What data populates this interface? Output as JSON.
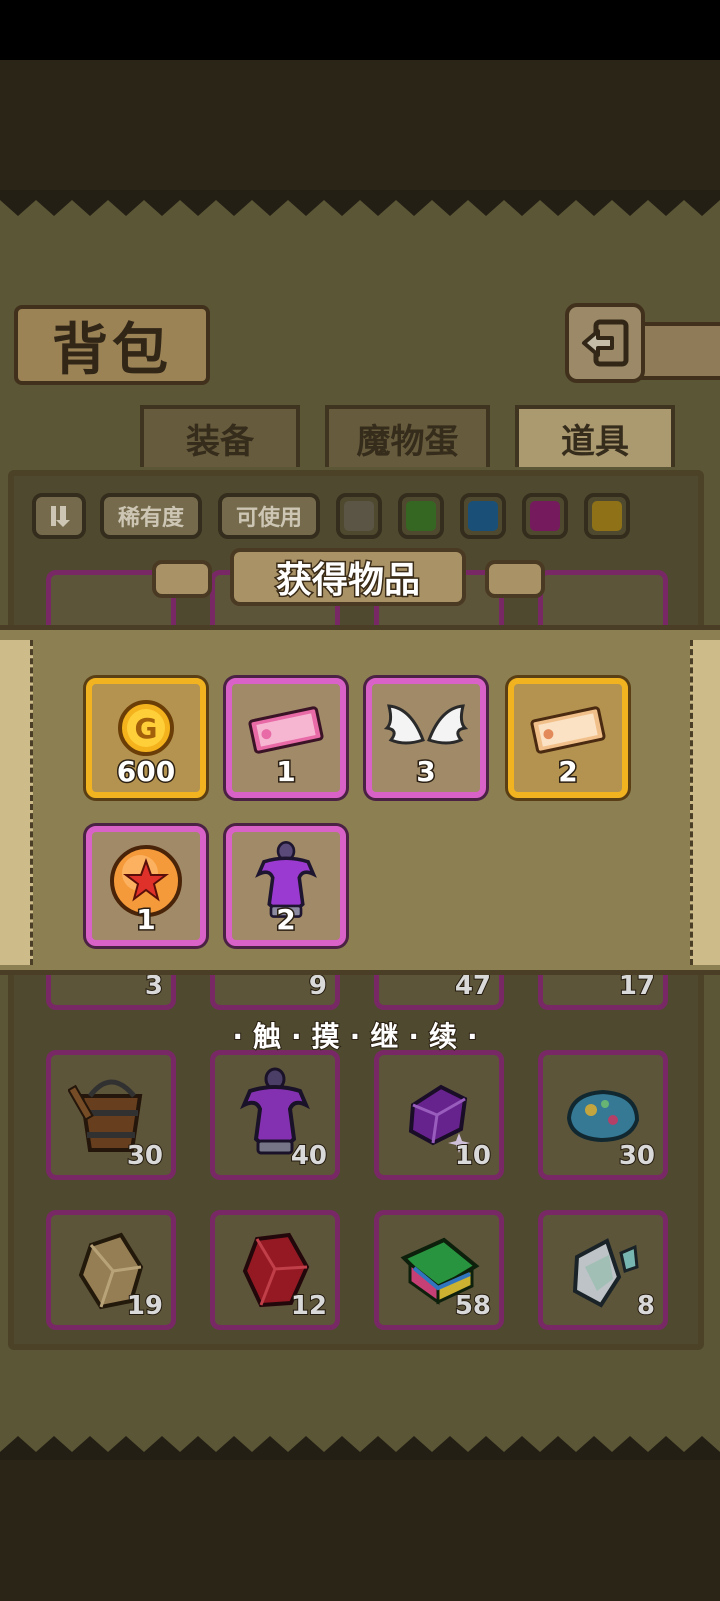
{
  "title": "背包",
  "tabs": [
    {
      "label": "装备",
      "active": false
    },
    {
      "label": "魔物蛋",
      "active": false
    },
    {
      "label": "道具",
      "active": true
    }
  ],
  "filters": {
    "rarity_label": "稀有度",
    "usable_label": "可使用",
    "colors": [
      "#6b6452",
      "#3f7a2a",
      "#1f5e8c",
      "#8a1f6e",
      "#a8861c"
    ]
  },
  "reward_popup": {
    "title": "获得物品",
    "items": [
      {
        "name": "gold-coin-icon",
        "count": "600",
        "rarity": "gold"
      },
      {
        "name": "pink-ticket-icon",
        "count": "1",
        "rarity": "purple"
      },
      {
        "name": "angel-wings-icon",
        "count": "3",
        "rarity": "purple"
      },
      {
        "name": "gold-ticket-icon",
        "count": "2",
        "rarity": "gold"
      },
      {
        "name": "star-orb-icon",
        "count": "1",
        "rarity": "purple"
      },
      {
        "name": "purple-potion-icon",
        "count": "2",
        "rarity": "purple"
      }
    ]
  },
  "continue_text": "·触·摸·继·续·",
  "inventory": {
    "row_partial": [
      {
        "icon": "shield-icon",
        "count": "3"
      },
      {
        "icon": "item-icon",
        "count": "9"
      },
      {
        "icon": "item-icon",
        "count": "47"
      },
      {
        "icon": "item-icon",
        "count": "17"
      }
    ],
    "row2": [
      {
        "icon": "wooden-bucket-icon",
        "count": "30"
      },
      {
        "icon": "purple-potion-icon",
        "count": "40"
      },
      {
        "icon": "purple-gem-icon",
        "count": "10"
      },
      {
        "icon": "opal-stone-icon",
        "count": "30"
      }
    ],
    "row3": [
      {
        "icon": "topaz-crystal-icon",
        "count": "19"
      },
      {
        "icon": "ruby-gem-icon",
        "count": "12"
      },
      {
        "icon": "rainbow-book-icon",
        "count": "58"
      },
      {
        "icon": "prism-crystal-icon",
        "count": "8"
      }
    ]
  }
}
